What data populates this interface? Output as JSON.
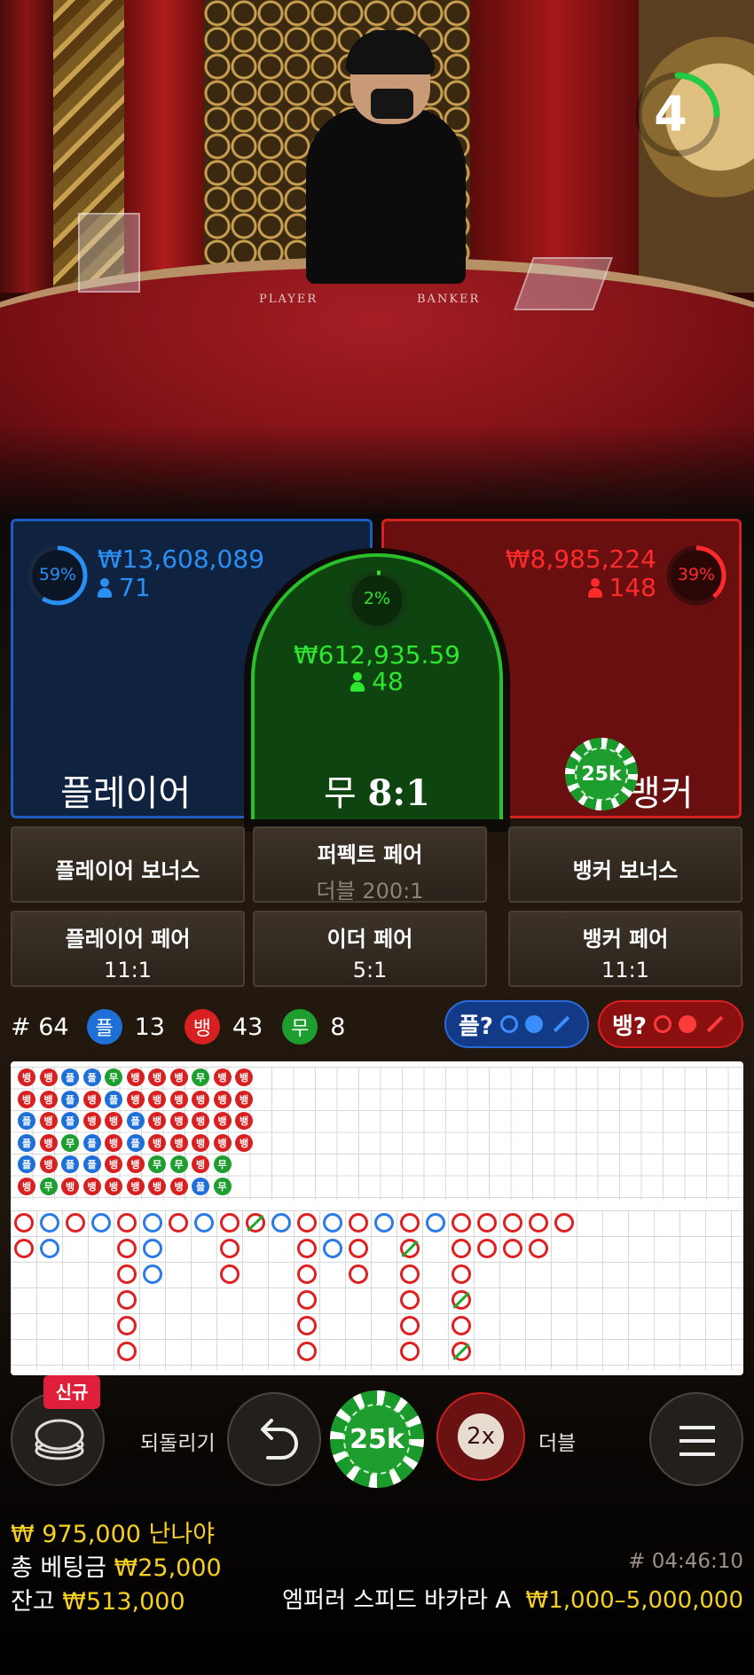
{
  "timer": {
    "value": "4",
    "fraction": 0.25,
    "color": "#22cc44"
  },
  "table_print": {
    "left": "PLAYER",
    "right": "BANKER"
  },
  "player": {
    "percent": "59%",
    "percent_value": 0.59,
    "amount": "₩13,608,089",
    "count": "71",
    "label": "플레이어",
    "color": "#2a8ff5"
  },
  "tie": {
    "percent": "2%",
    "percent_value": 0.02,
    "amount": "₩612,935.59",
    "count": "48",
    "label": "무",
    "odds": "8:1",
    "color": "#2ee62e"
  },
  "banker": {
    "percent": "39%",
    "percent_value": 0.39,
    "amount": "₩8,985,224",
    "count": "148",
    "label": "뱅커",
    "color": "#ff2a2a",
    "chip": "25k"
  },
  "side_bets": [
    {
      "title": "플레이어 보너스",
      "odds": ""
    },
    {
      "title": "퍼펙트 페어",
      "odds": "더블 200:1"
    },
    {
      "title": "뱅커 보너스",
      "odds": ""
    },
    {
      "title": "플레이어 페어",
      "odds": "11:1"
    },
    {
      "title": "이더 페어",
      "odds": "5:1"
    },
    {
      "title": "뱅커 페어",
      "odds": "11:1"
    }
  ],
  "stats": {
    "round": "# 64",
    "player_badge": "플",
    "player_count": "13",
    "banker_badge": "뱅",
    "banker_count": "43",
    "tie_badge": "무",
    "tie_count": "8",
    "player_predict": "플?",
    "banker_predict": "뱅?"
  },
  "bead_road": [
    [
      "뱅",
      "뱅",
      "플",
      "플",
      "플",
      "뱅"
    ],
    [
      "뱅",
      "뱅",
      "뱅",
      "뱅",
      "뱅",
      "무"
    ],
    [
      "플",
      "플",
      "플",
      "무",
      "플",
      "뱅"
    ],
    [
      "플",
      "뱅",
      "뱅",
      "플",
      "플",
      "뱅"
    ],
    [
      "무",
      "플",
      "뱅",
      "뱅",
      "뱅",
      "뱅"
    ],
    [
      "뱅",
      "뱅",
      "플",
      "플",
      "뱅",
      "뱅"
    ],
    [
      "뱅",
      "뱅",
      "뱅",
      "뱅",
      "무",
      "뱅"
    ],
    [
      "뱅",
      "뱅",
      "뱅",
      "뱅",
      "무",
      "뱅"
    ],
    [
      "무",
      "뱅",
      "뱅",
      "뱅",
      "뱅",
      "플"
    ],
    [
      "뱅",
      "뱅",
      "뱅",
      "뱅",
      "무",
      "무"
    ],
    [
      "뱅",
      "뱅",
      "뱅",
      "뱅",
      "",
      ""
    ]
  ],
  "controls": {
    "new_badge": "신규",
    "undo_label": "되돌리기",
    "chip_value": "25k",
    "double_value": "2x",
    "double_label": "더블"
  },
  "footer": {
    "win_amount": "₩ 975,000 난나야",
    "total_bet_label": "총 베팅금",
    "total_bet": "₩25,000",
    "balance_label": "잔고",
    "balance": "₩513,000",
    "game_id": "# 04:46:10",
    "table_name": "엠퍼러 스피드 바카라 A",
    "limits": "₩1,000–5,000,000"
  }
}
